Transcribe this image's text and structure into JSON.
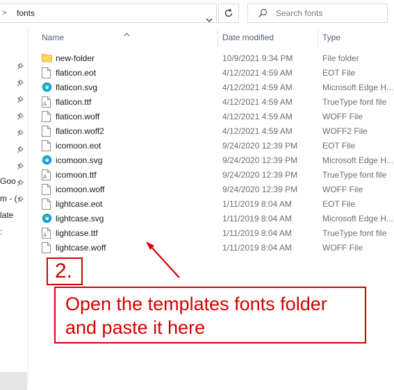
{
  "address_bar": {
    "folder": "fonts"
  },
  "search": {
    "placeholder": "Search fonts"
  },
  "nav": {
    "fragments": [
      "Goo",
      "m - (",
      "late",
      ":"
    ]
  },
  "columns": {
    "name": "Name",
    "date": "Date modified",
    "type": "Type"
  },
  "files": [
    {
      "name": "new-folder",
      "date": "10/9/2021 9:34 PM",
      "type": "File folder",
      "icon": "folder-icon"
    },
    {
      "name": "flaticon.eot",
      "date": "4/12/2021 4:59 AM",
      "type": "EOT File",
      "icon": "file-icon"
    },
    {
      "name": "flaticon.svg",
      "date": "4/12/2021 4:59 AM",
      "type": "Microsoft Edge H...",
      "icon": "edge-icon"
    },
    {
      "name": "flaticon.ttf",
      "date": "4/12/2021 4:59 AM",
      "type": "TrueType font file",
      "icon": "font-file-icon"
    },
    {
      "name": "flaticon.woff",
      "date": "4/12/2021 4:59 AM",
      "type": "WOFF File",
      "icon": "file-icon"
    },
    {
      "name": "flaticon.woff2",
      "date": "4/12/2021 4:59 AM",
      "type": "WOFF2 File",
      "icon": "file-icon"
    },
    {
      "name": "icomoon.eot",
      "date": "9/24/2020 12:39 PM",
      "type": "EOT File",
      "icon": "file-icon"
    },
    {
      "name": "icomoon.svg",
      "date": "9/24/2020 12:39 PM",
      "type": "Microsoft Edge H...",
      "icon": "edge-icon"
    },
    {
      "name": "icomoon.ttf",
      "date": "9/24/2020 12:39 PM",
      "type": "TrueType font file",
      "icon": "font-file-icon"
    },
    {
      "name": "icomoon.woff",
      "date": "9/24/2020 12:39 PM",
      "type": "WOFF File",
      "icon": "file-icon"
    },
    {
      "name": "lightcase.eot",
      "date": "1/11/2019 8:04 AM",
      "type": "EOT File",
      "icon": "file-icon"
    },
    {
      "name": "lightcase.svg",
      "date": "1/11/2019 8:04 AM",
      "type": "Microsoft Edge H...",
      "icon": "edge-icon"
    },
    {
      "name": "lightcase.ttf",
      "date": "1/11/2019 8:04 AM",
      "type": "TrueType font file",
      "icon": "font-file-icon"
    },
    {
      "name": "lightcase.woff",
      "date": "1/11/2019 8:04 AM",
      "type": "WOFF File",
      "icon": "file-icon"
    }
  ],
  "annotation": {
    "step": "2.",
    "line1": "Open the templates fonts folder",
    "line2": "and paste it here",
    "color": "#d40000"
  }
}
